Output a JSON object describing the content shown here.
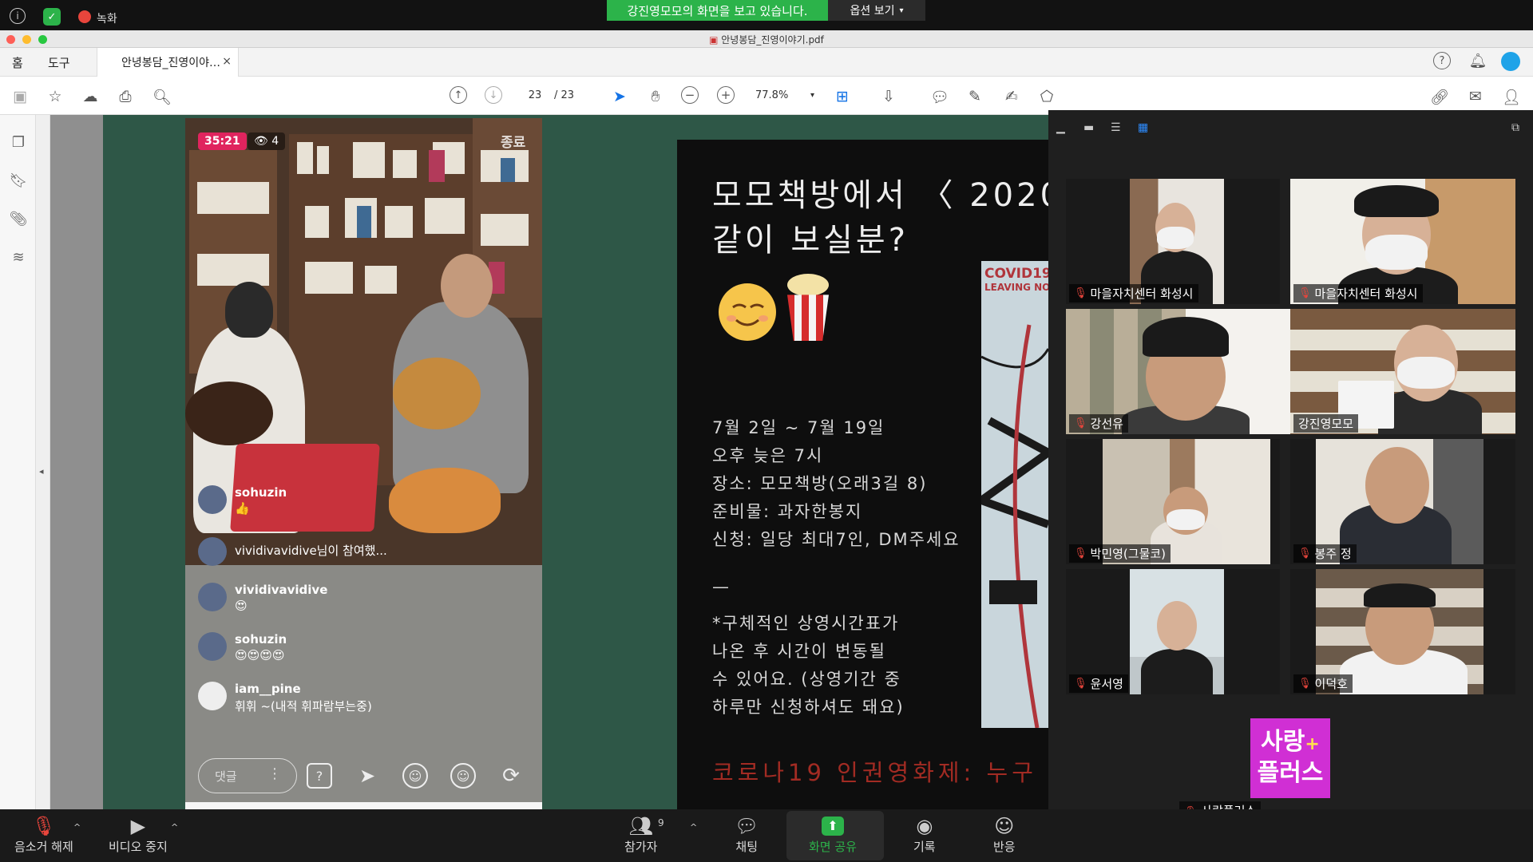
{
  "zoom_top": {
    "recording_label": "녹화",
    "share_banner": "강진영모모의 화면을 보고 있습니다.",
    "view_options": "옵션 보기",
    "colors": {
      "banner": "#2cb34a",
      "recording": "#e8453c",
      "shield": "#2cb34a"
    }
  },
  "acrobat": {
    "window_title": "안녕봉담_진영이야기.pdf",
    "menu_home": "홈",
    "menu_tools": "도구",
    "tab_title": "안녕봉담_진영이야…",
    "tab_close": "×",
    "page_current": "23",
    "page_total": "/ 23",
    "zoom": "77.8%"
  },
  "instagram": {
    "timer": "35:21",
    "viewers": "👁 4",
    "end": "종료",
    "comments": [
      {
        "user": "sohuzin",
        "text": "👍"
      },
      {
        "user": "",
        "text": "vividivavidive님이 참여했..."
      },
      {
        "user": "vividivavidive",
        "text": "😍"
      },
      {
        "user": "sohuzin",
        "text": "😍😍😍😍"
      },
      {
        "user": "iam__pine",
        "text": "휘휘 ~(내적 휘파람부는중)"
      }
    ],
    "comment_placeholder": "댓글"
  },
  "slide": {
    "title_line1": "모모책방에서 〈 2020",
    "title_line2": "같이 보실분?",
    "lines": [
      "7월 2일 ~ 7월 19일",
      "오후 늦은 7시",
      "장소: 모모책방(오래3길 8)",
      "준비물: 과자한봉지",
      "신청: 일당 최대7인, DM주세요",
      "—",
      "*구체적인 상영시간표가",
      "나온 후 시간이 변동될",
      "수 있어요. (상영기간 중",
      "하루만 신청하셔도 돼요)"
    ],
    "red_line": "코로나19 인권영화제: 누구",
    "poster_title": "COVID19",
    "poster_sub": "LEAVING NO"
  },
  "participants": [
    "마을자치센터 화성시",
    "마을자치센터 화성시",
    "강선유",
    "강진영모모",
    "박민영(그물코)",
    "봉주 정",
    "윤서영",
    "이덕호",
    "사랑플러스"
  ],
  "sarang_logo": "사랑+ 플러스",
  "bottom": {
    "mute": "음소거 해제",
    "video": "비디오 중지",
    "participants": "참가자",
    "participant_count": "9",
    "chat": "채팅",
    "share": "화면 공유",
    "record": "기록",
    "reactions": "반응",
    "colors": {
      "share_icon": "#2cb34a",
      "share_text": "#2cb34a"
    }
  }
}
